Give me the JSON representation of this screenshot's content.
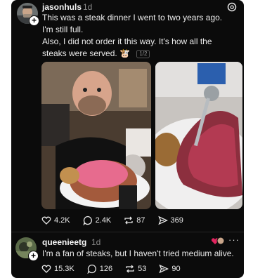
{
  "post": {
    "username": "jasonhuls",
    "time": "1d",
    "text_line1": "This was a steak dinner I went to two years ago. I'm still full.",
    "text_line2": "Also, I did not order it this way. It's how all the steaks were served.",
    "emoji": "🐮",
    "pager": "1/2",
    "likes": "4.2K",
    "comments": "2.4K",
    "reposts": "87",
    "shares": "369"
  },
  "reply": {
    "username": "queenieetg",
    "time": "1d",
    "text": "I'm a fan of steaks, but I haven't tried medium alive.",
    "likes": "15.3K",
    "comments": "126",
    "reposts": "53",
    "shares": "90"
  },
  "colors": {
    "background": "#0b0b0b",
    "text": "#f3f3f3",
    "muted": "#8a8a8a",
    "steak": "#c0455c"
  }
}
